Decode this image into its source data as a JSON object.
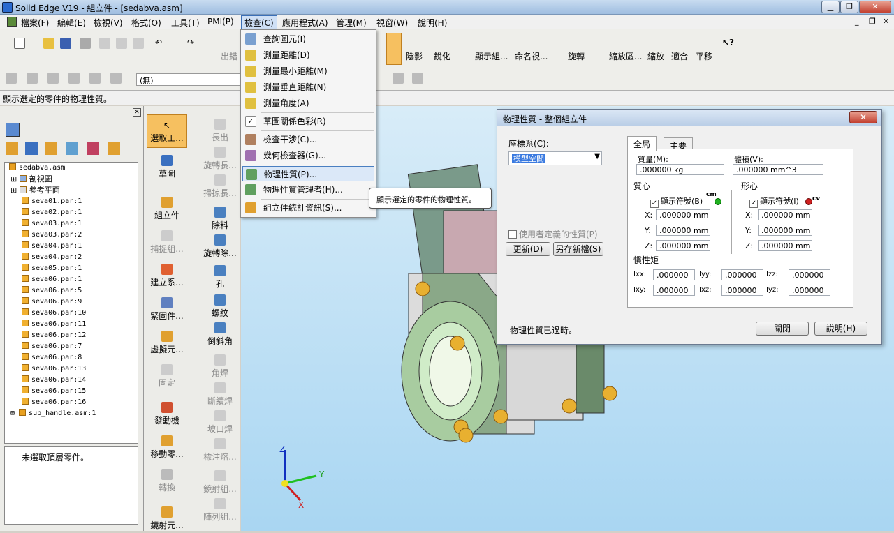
{
  "window": {
    "title": "Solid Edge V19 - 組立件 - [sedabva.asm]"
  },
  "menubar": [
    "檔案(F)",
    "編輯(E)",
    "檢視(V)",
    "格式(O)",
    "工具(T)",
    "PMI(P)",
    "檢查(C)",
    "應用程式(A)",
    "管理(M)",
    "視窗(W)",
    "說明(H)"
  ],
  "toolbar1": {
    "labels": [
      "出錯",
      "陰影",
      "銳化",
      "顯示組...",
      "命名視...",
      "旋轉",
      "縮放區...",
      "縮放",
      "適合",
      "平移"
    ]
  },
  "toolbar2": {
    "style_value": "(無)"
  },
  "status": "顯示選定的零件的物理性質。",
  "tree": {
    "items": [
      "sedabva.asm",
      "剖視圖",
      "參考平面",
      "seva01.par:1",
      "seva02.par:1",
      "seva03.par:1",
      "seva03.par:2",
      "seva04.par:1",
      "seva04.par:2",
      "seva05.par:1",
      "seva06.par:1",
      "seva06.par:5",
      "seva06.par:9",
      "seva06.par:10",
      "seva06.par:11",
      "seva06.par:12",
      "seva06.par:7",
      "seva06.par:8",
      "seva06.par:13",
      "seva06.par:14",
      "seva06.par:15",
      "seva06.par:16",
      "sub_handle.asm:1"
    ],
    "bottom_message": "未選取頂層零件。"
  },
  "commands": {
    "col1": [
      "選取工...",
      "草圖",
      "組立件",
      "捕捉組...",
      "建立系...",
      "緊固件...",
      "虛擬元...",
      "固定",
      "發動機",
      "移動零...",
      "轉換",
      "鏡射元..."
    ],
    "col2": [
      "長出",
      "旋轉長...",
      "掃掠長...",
      "除料",
      "旋轉除...",
      "孔",
      "螺紋",
      "倒斜角",
      "角焊",
      "斷續焊",
      "坡口焊",
      "標注熔...",
      "鏡射組...",
      "陣列組..."
    ]
  },
  "dropdown": {
    "items": [
      "查詢圖元(I)",
      "測量距離(D)",
      "測量最小距離(M)",
      "測量垂直距離(N)",
      "測量角度(A)",
      "草圖關係色彩(R)",
      "檢查干涉(C)...",
      "幾何檢查器(G)...",
      "物理性質(P)...",
      "物理性質管理者(H)...",
      "組立件統計資訊(S)..."
    ]
  },
  "tooltip": "顯示選定的零件的物理性質。",
  "dialog": {
    "title": "物理性質 - 整個組立件",
    "close_label": "✕",
    "coord_label": "座標系(C):",
    "coord_value": "模型空間",
    "user_defined": "使用者定義的性質(P)",
    "update_btn": "更新(D)",
    "save_btn": "另存新檔(S)",
    "tabs": [
      "全局",
      "主要"
    ],
    "mass_label": "質量(M):",
    "mass_value": ".000000 kg",
    "volume_label": "體積(V):",
    "volume_value": ".000000 mm^3",
    "cog_label": "質心",
    "centroid_label": "形心",
    "show_cog": "顯示符號(B)",
    "show_centroid": "顯示符號(I)",
    "cm_tag": "cm",
    "cv_tag": "cv",
    "coords": {
      "x": ".000000 mm",
      "y": ".000000 mm",
      "z": ".000000 mm"
    },
    "axis_x": "X:",
    "axis_y": "Y:",
    "axis_z": "Z:",
    "inertia_label": "慣性矩",
    "inertia": {
      "Ixx": ".000000",
      "Iyy": ".000000",
      "Izz": ".000000",
      "Ixy": ".000000",
      "Ixz": ".000000",
      "Iyz": ".000000"
    },
    "ixx": "Ixx:",
    "iyy": "Iyy:",
    "izz": "Izz:",
    "ixy": "Ixy:",
    "ixz": "Ixz:",
    "iyz": "Iyz:",
    "status": "物理性質已過時。",
    "close_btn": "關閉",
    "help_btn": "說明(H)"
  },
  "triad": {
    "x": "X",
    "y": "Y",
    "z": "Z"
  }
}
